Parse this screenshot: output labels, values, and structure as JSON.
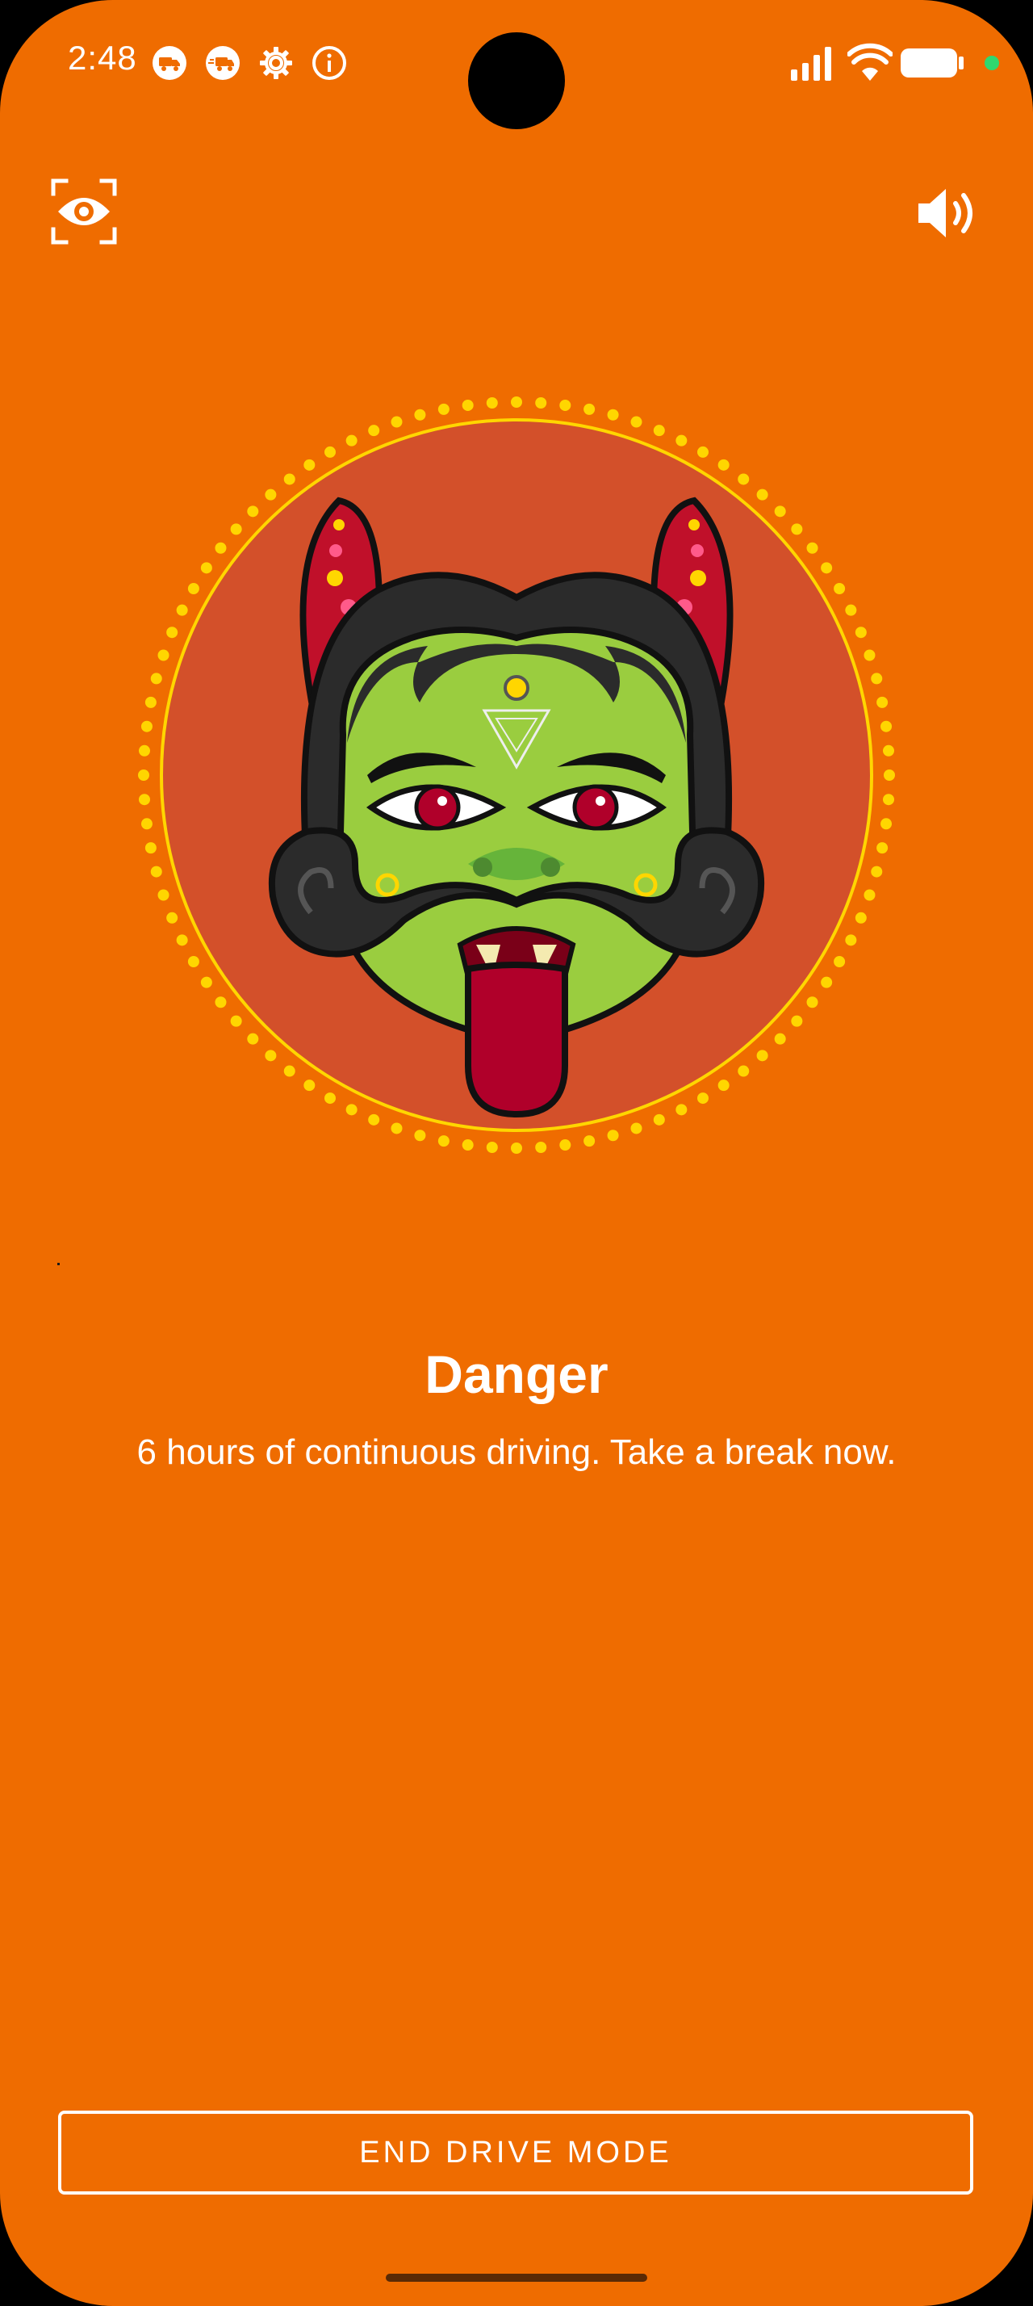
{
  "status_bar": {
    "time": "2:48",
    "left_icons": [
      "delivery-truck-icon",
      "fast-delivery-icon",
      "settings-gear-icon",
      "info-icon"
    ],
    "right_icons": [
      "signal-icon",
      "wifi-icon",
      "battery-icon",
      "privacy-dot-icon"
    ]
  },
  "controls": {
    "eye_icon": "eye-scan-icon",
    "sound_icon": "volume-icon"
  },
  "alert": {
    "title": "Danger",
    "message": "6 hours of continuous driving. Take a break now."
  },
  "button": {
    "end_label": "END DRIVE MODE"
  },
  "colors": {
    "background": "#ef6c00",
    "circle": "#d3502a",
    "dots": "#ffd600",
    "face": "#9acd3f",
    "hair": "#2b2b2b",
    "horn": "#c0102a",
    "tongue": "#b0002a"
  }
}
